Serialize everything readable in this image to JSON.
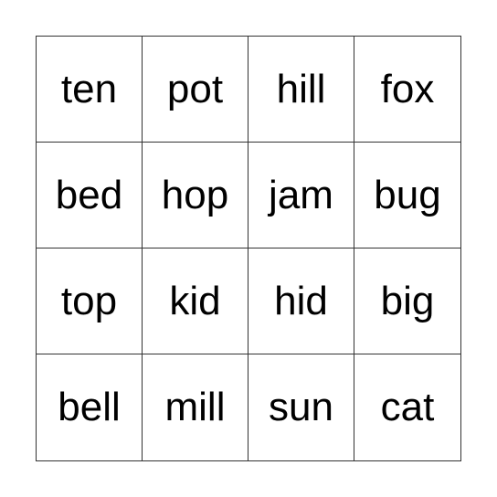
{
  "card": {
    "cells": [
      "ten",
      "pot",
      "hill",
      "fox",
      "bed",
      "hop",
      "jam",
      "bug",
      "top",
      "kid",
      "hid",
      "big",
      "bell",
      "mill",
      "sun",
      "cat"
    ]
  }
}
